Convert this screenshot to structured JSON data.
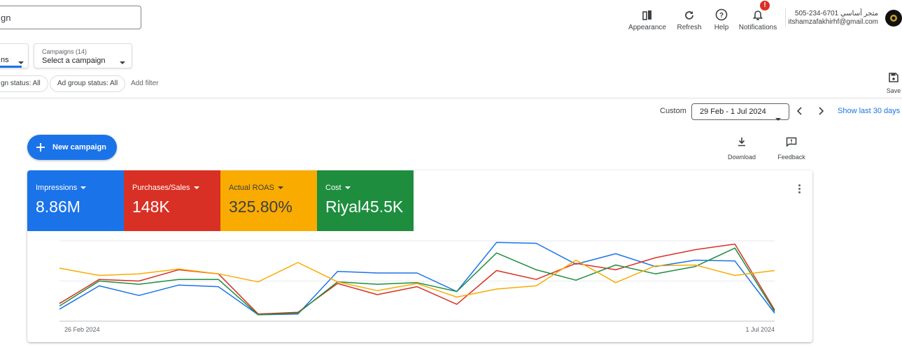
{
  "search": {
    "value": "gn"
  },
  "top_actions": [
    {
      "label": "Appearance",
      "icon": "appearance-icon"
    },
    {
      "label": "Refresh",
      "icon": "refresh-icon"
    },
    {
      "label": "Help",
      "icon": "help-icon"
    },
    {
      "label": "Notifications",
      "icon": "bell-icon",
      "badge": "!"
    }
  ],
  "account": {
    "line1": "505-234-6701 متجر أساسي",
    "email": "itshamzafakhirhf@gmail.com"
  },
  "view_selector": {
    "value": "ns"
  },
  "campaign_selector": {
    "label": "Campaigns (14)",
    "value": "Select a campaign"
  },
  "filters": {
    "campaign_status": "gn status: All",
    "ad_group_status": "Ad group status: All",
    "add_filter": "Add filter"
  },
  "save": {
    "label": "Save"
  },
  "date": {
    "custom_label": "Custom",
    "range": "29 Feb - 1 Jul 2024",
    "show_last": "Show last 30 days"
  },
  "new_campaign": {
    "label": "New campaign"
  },
  "tools": {
    "download": "Download",
    "feedback": "Feedback"
  },
  "metrics": [
    {
      "label": "Impressions",
      "value": "8.86M",
      "bg": "#1a73e8",
      "fg": "#ffffff"
    },
    {
      "label": "Purchases/Sales",
      "value": "148K",
      "bg": "#d93025",
      "fg": "#ffffff"
    },
    {
      "label": "Actual ROAS",
      "value": "325.80%",
      "bg": "#f9ab00",
      "fg": "#3c4043"
    },
    {
      "label": "Cost",
      "value": "Riyal45.5K",
      "bg": "#1e8e3e",
      "fg": "#ffffff"
    }
  ],
  "chart_data": {
    "type": "line",
    "x_start_label": "26 Feb 2024",
    "x_end_label": "1 Jul 2024",
    "grid": true,
    "ylim": [
      0,
      100
    ],
    "series": [
      {
        "color": "#1a73e8",
        "values": [
          15,
          44,
          32,
          45,
          43,
          8,
          9,
          62,
          60,
          60,
          37,
          98,
          97,
          71,
          84,
          68,
          76,
          75,
          10
        ]
      },
      {
        "color": "#d93025",
        "values": [
          22,
          52,
          50,
          64,
          59,
          9,
          11,
          47,
          33,
          43,
          21,
          63,
          52,
          72,
          64,
          79,
          89,
          96,
          14
        ]
      },
      {
        "color": "#1e8e3e",
        "values": [
          19,
          50,
          46,
          52,
          52,
          8,
          10,
          49,
          46,
          48,
          37,
          85,
          64,
          51,
          70,
          59,
          68,
          91,
          12
        ]
      },
      {
        "color": "#f9ab00",
        "values": [
          66,
          57,
          59,
          65,
          59,
          49,
          73,
          49,
          38,
          47,
          30,
          40,
          44,
          76,
          48,
          69,
          70,
          57,
          63
        ]
      }
    ]
  }
}
